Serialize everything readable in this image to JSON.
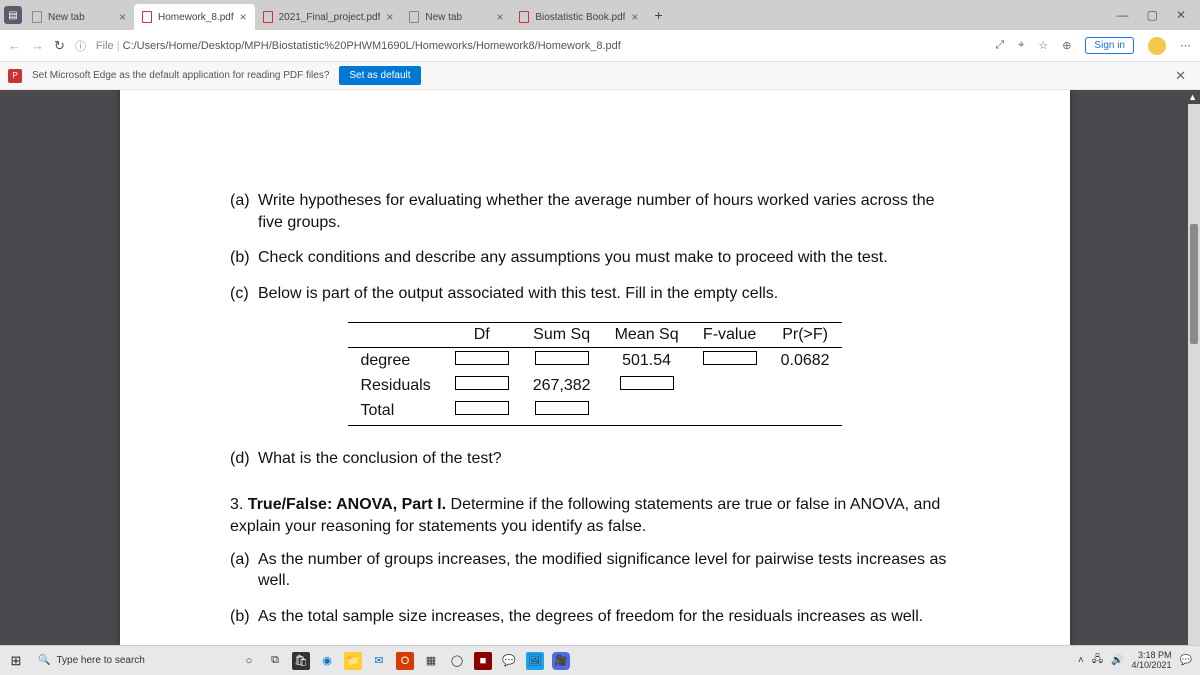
{
  "tabs": [
    {
      "label": "New tab",
      "pdf": false
    },
    {
      "label": "Homework_8.pdf",
      "pdf": true,
      "active": true
    },
    {
      "label": "2021_Final_project.pdf",
      "pdf": true
    },
    {
      "label": "New tab",
      "pdf": false
    },
    {
      "label": "Biostatistic Book.pdf",
      "pdf": true
    }
  ],
  "url_prefix": "File",
  "url_path": "C:/Users/Home/Desktop/MPH/Biostatistic%20PHWM1690L/Homeworks/Homework8/Homework_8.pdf",
  "signin": "Sign in",
  "info_msg": "Set Microsoft Edge as the default application for reading PDF files?",
  "set_default": "Set as default",
  "doc": {
    "a": "Write hypotheses for evaluating whether the average number of hours worked varies across the five groups.",
    "b": "Check conditions and describe any assumptions you must make to proceed with the test.",
    "c": "Below is part of the output associated with this test. Fill in the empty cells.",
    "d": "What is the conclusion of the test?",
    "q3_intro": "3. True/False: ANOVA, Part I. Determine if the following statements are true or false in ANOVA, and explain your reasoning for statements you identify as false.",
    "q3a": "As the number of groups increases, the modified significance level for pairwise tests increases as well.",
    "q3b": "As the total sample size increases, the degrees of freedom for the residuals increases as well."
  },
  "anova": {
    "headers": [
      "",
      "Df",
      "Sum Sq",
      "Mean Sq",
      "F-value",
      "Pr(>F)"
    ],
    "rows": [
      {
        "name": "degree",
        "meansq": "501.54",
        "pr": "0.0682"
      },
      {
        "name": "Residuals",
        "sumsq": "267,382"
      }
    ],
    "total": "Total"
  },
  "search_placeholder": "Type here to search",
  "clock": {
    "time": "3:18 PM",
    "date": "4/10/2021"
  }
}
